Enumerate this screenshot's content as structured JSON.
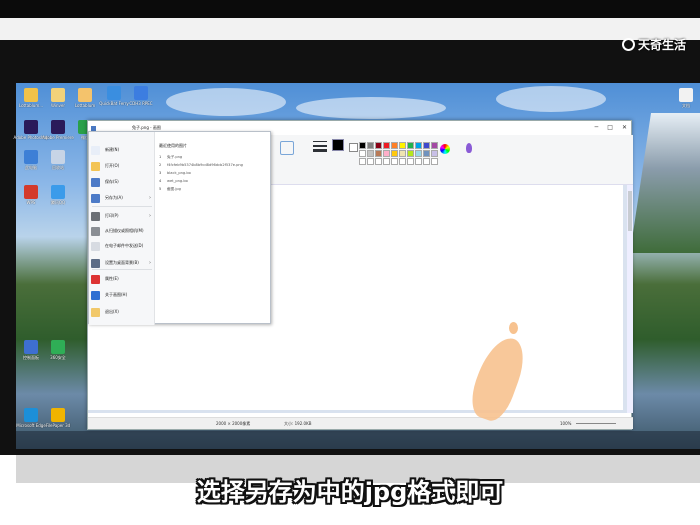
{
  "watermark": {
    "brand": "天奇生活",
    "brand_alt": "天奇·"
  },
  "desktop": {
    "icons": [
      {
        "label": "Lottablum...",
        "color": "#f0c24a"
      },
      {
        "label": "Winver",
        "color": "#f2d27a"
      },
      {
        "label": "Lottablum",
        "color": "#f4c36c"
      },
      {
        "label": "QuickBat Ferry",
        "color": "#3a8ee0"
      },
      {
        "label": "CDH3 RPEC",
        "color": "#3c7de0"
      },
      {
        "label": "Adobe Photoshop",
        "color": "#2a1a5a"
      },
      {
        "label": "Adobe Premiere",
        "color": "#2a1a5a"
      },
      {
        "label": "微信",
        "color": "#2aa04a"
      },
      {
        "label": "此电脑",
        "color": "#3d7fd6"
      },
      {
        "label": "回收站",
        "color": "#c7d4e6"
      },
      {
        "label": "WPS",
        "color": "#d33a2c"
      },
      {
        "label": "腾讯QQ",
        "color": "#3b9bea"
      },
      {
        "label": "控制面板",
        "color": "#3e6fd0"
      },
      {
        "label": "360安全",
        "color": "#2fae56"
      },
      {
        "label": "Microsoft Edge",
        "color": "#1c8fd8"
      },
      {
        "label": "FilePaper 3d",
        "color": "#f0b400"
      }
    ],
    "right_icon": "文档"
  },
  "paint": {
    "title": "兔子.png - 画图",
    "file_button": "文件",
    "ribbon_groups": [
      "图像",
      "工具",
      "形状",
      "颜色"
    ],
    "palette": [
      "#000000",
      "#7f7f7f",
      "#880015",
      "#ed1c24",
      "#ff7f27",
      "#fff200",
      "#22b14c",
      "#00a2e8",
      "#3f48cc",
      "#a349a4",
      "#ffffff",
      "#c3c3c3",
      "#b97a57",
      "#ffaec9",
      "#ffc90e",
      "#efe4b0",
      "#b5e61d",
      "#99d9ea",
      "#7092be",
      "#c8bfe7",
      "#ffffff",
      "#ffffff",
      "#ffffff",
      "#ffffff",
      "#ffffff",
      "#ffffff",
      "#ffffff",
      "#ffffff",
      "#ffffff",
      "#ffffff"
    ],
    "status": {
      "size": "2000 × 2000像素",
      "file_size": "大小: 192.0KB",
      "zoom": "100%"
    },
    "file_menu": {
      "items": [
        {
          "label": "新建(N)",
          "icon": "new-file-icon",
          "color": "#e8eef8",
          "arrow": false
        },
        {
          "label": "打开(O)",
          "icon": "open-folder-icon",
          "color": "#f3c455",
          "arrow": false
        },
        {
          "label": "保存(S)",
          "icon": "save-icon",
          "color": "#4c7ac7",
          "arrow": false
        },
        {
          "label": "另存为(A)",
          "icon": "save-as-icon",
          "color": "#4c7ac7",
          "arrow": true
        },
        {
          "label": "打印(P)",
          "icon": "printer-icon",
          "color": "#6b6f75",
          "arrow": true
        },
        {
          "label": "从扫描仪或照相机(M)",
          "icon": "scanner-icon",
          "color": "#8a8e94",
          "arrow": false
        },
        {
          "label": "在电子邮件中发送(D)",
          "icon": "email-icon",
          "color": "#d7dbe2",
          "arrow": false
        },
        {
          "label": "设置为桌面背景(B)",
          "icon": "desktop-background-icon",
          "color": "#5c6c86",
          "arrow": true
        },
        {
          "label": "属性(E)",
          "icon": "properties-check-icon",
          "color": "#d33",
          "arrow": false
        },
        {
          "label": "关于画图(H)",
          "icon": "info-icon",
          "color": "#2e6fd2",
          "arrow": false
        },
        {
          "label": "退出(X)",
          "icon": "exit-icon",
          "color": "#f1c86a",
          "arrow": false
        }
      ],
      "recent_title": "最近使用的图片",
      "recent": [
        {
          "num": "1",
          "name": "兔子.png"
        },
        {
          "num": "2",
          "name": "f4fcfeb9b5374b8b9cd8d96dcb2f537e.png"
        },
        {
          "num": "3",
          "name": "black_png.bo"
        },
        {
          "num": "4",
          "name": "wet_png.bo"
        },
        {
          "num": "5",
          "name": "截图.jpg"
        }
      ]
    }
  },
  "caption": "选择另存为中的jpg格式即可"
}
